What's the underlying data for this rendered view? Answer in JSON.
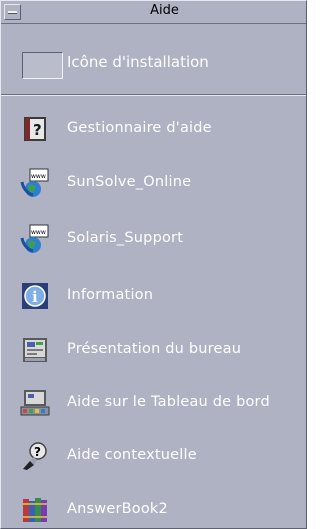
{
  "window": {
    "title": "Aide"
  },
  "install_area": {
    "label": "Icône d'installation"
  },
  "items": [
    {
      "label": "Gestionnaire d'aide",
      "icon": "help-book-icon"
    },
    {
      "label": "SunSolve_Online",
      "icon": "www-globe-icon"
    },
    {
      "label": "Solaris_Support",
      "icon": "www-globe-icon"
    },
    {
      "label": "Information",
      "icon": "info-icon"
    },
    {
      "label": "Présentation du bureau",
      "icon": "desktop-screen-icon"
    },
    {
      "label": "Aide sur le Tableau de bord",
      "icon": "front-panel-icon"
    },
    {
      "label": "Aide contextuelle",
      "icon": "contextual-help-icon"
    },
    {
      "label": "AnswerBook2",
      "icon": "books-icon"
    }
  ],
  "colors": {
    "panel": "#aeb2c3",
    "text": "#ffffff"
  }
}
